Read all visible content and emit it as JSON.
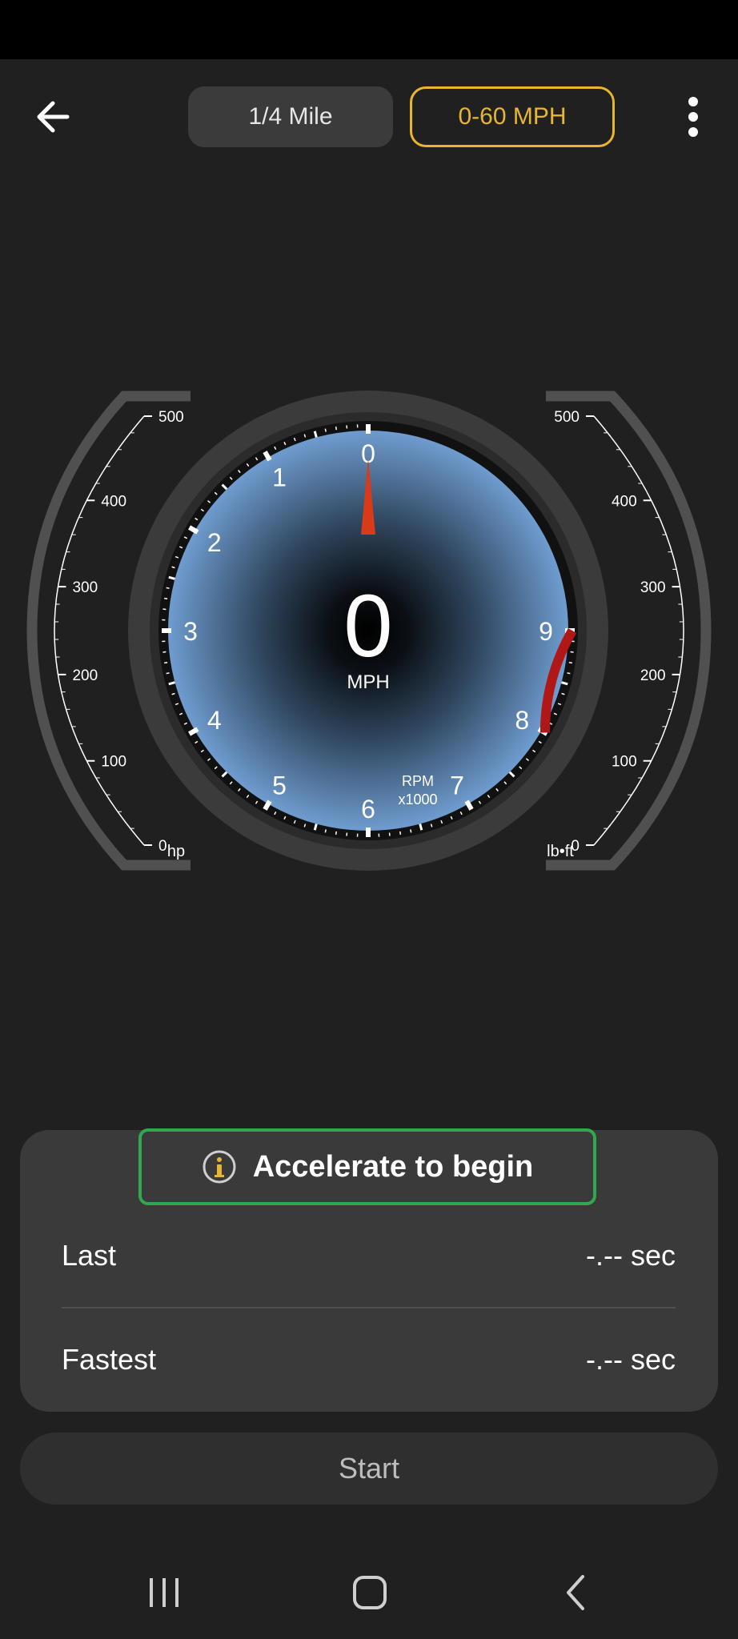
{
  "header": {
    "tabs": [
      {
        "label": "1/4 Mile",
        "active": false
      },
      {
        "label": "0-60 MPH",
        "active": true
      }
    ]
  },
  "gauge": {
    "speed_value": "0",
    "speed_unit": "MPH",
    "rpm_label": "RPM",
    "rpm_multiplier": "x1000",
    "rpm_ticks": [
      "0",
      "1",
      "2",
      "3",
      "4",
      "5",
      "6",
      "7",
      "8",
      "9"
    ],
    "rpm_current": 0,
    "redline_from_rpm": 8,
    "power": {
      "unit": "hp",
      "ticks": [
        "0",
        "100",
        "200",
        "300",
        "400",
        "500"
      ]
    },
    "torque": {
      "unit": "lb•ft",
      "ticks": [
        "0",
        "100",
        "200",
        "300",
        "400",
        "500"
      ]
    }
  },
  "status": {
    "message": "Accelerate to begin"
  },
  "results": {
    "last": {
      "label": "Last",
      "value": "-.-- sec"
    },
    "fastest": {
      "label": "Fastest",
      "value": "-.-- sec"
    }
  },
  "start_button": {
    "label": "Start"
  },
  "colors": {
    "accent": "#e8b62e",
    "success_border": "#2fa84f",
    "needle": "#d93a1a",
    "redline": "#b01818",
    "dial_inner": "#6f9ccf"
  },
  "icons": {
    "back": "arrow-left-icon",
    "menu": "more-vertical-icon",
    "info": "info-icon",
    "nav_recents": "recent-apps-icon",
    "nav_home": "home-icon",
    "nav_back": "nav-back-icon"
  }
}
